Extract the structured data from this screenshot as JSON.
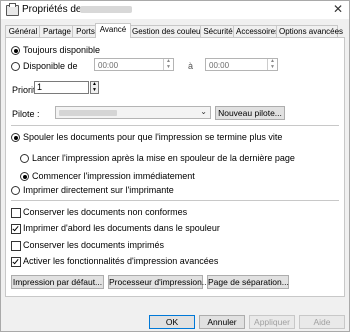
{
  "window": {
    "title": "Propriétés de"
  },
  "tabs": [
    "Général",
    "Partage",
    "Ports",
    "Avancé",
    "Gestion des couleurs",
    "Sécurité",
    "Accessoires",
    "Options avancées"
  ],
  "active_tab": "Avancé",
  "availability": {
    "always_label": "Toujours disponible",
    "from_label": "Disponible de",
    "from_time": "00:00",
    "to_label": "à",
    "to_time": "00:00",
    "selected": "always"
  },
  "priority": {
    "label": "Priorité :",
    "value": "1"
  },
  "driver": {
    "label": "Pilote :",
    "new_button": "Nouveau pilote..."
  },
  "spool": {
    "spool_label": "Spouler les documents pour que l'impression se termine plus vite",
    "after_last_page": "Lancer l'impression après la mise en spouleur de la dernière page",
    "immediately": "Commencer l'impression immédiatement",
    "direct": "Imprimer directement sur l'imprimante"
  },
  "options": [
    {
      "label": "Conserver les documents non conformes",
      "checked": false
    },
    {
      "label": "Imprimer d'abord les documents dans le spouleur",
      "checked": true
    },
    {
      "label": "Conserver les documents imprimés",
      "checked": false
    },
    {
      "label": "Activer les fonctionnalités d'impression avancées",
      "checked": true
    }
  ],
  "bottom_buttons": {
    "defaults": "Impression par défaut...",
    "processor": "Processeur d'impression...",
    "separator": "Page de séparation..."
  },
  "dialog_buttons": {
    "ok": "OK",
    "cancel": "Annuler",
    "apply": "Appliquer",
    "help": "Aide"
  }
}
